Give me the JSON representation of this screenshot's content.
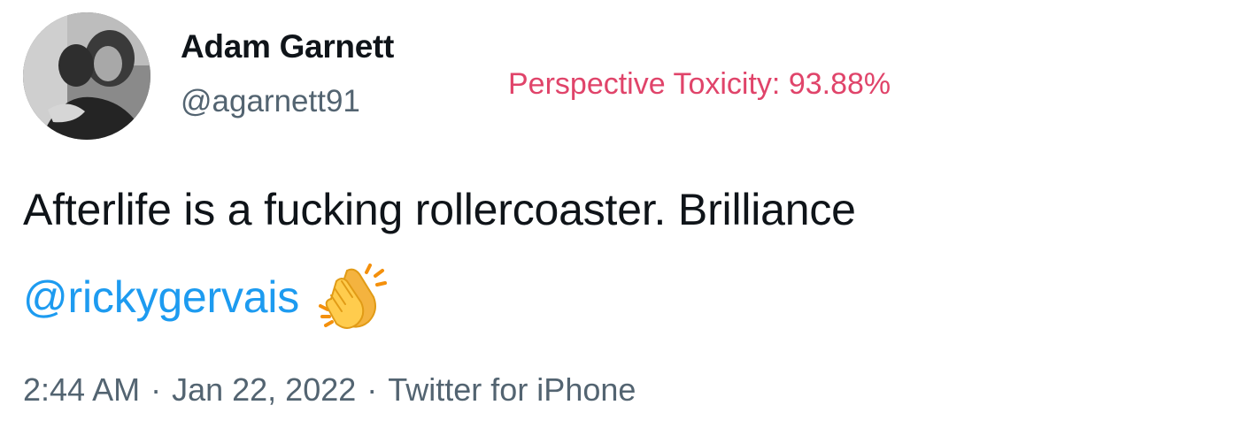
{
  "user": {
    "display_name": "Adam Garnett",
    "handle": "@agarnett91"
  },
  "annotation": {
    "toxicity_label": "Perspective Toxicity: 93.88%",
    "color": "#e0446a"
  },
  "tweet": {
    "text_line1": "Afterlife is a fucking rollercoaster. Brilliance",
    "mention": "@rickygervais",
    "emoji_icon": "clapping-hands-icon"
  },
  "meta": {
    "time": "2:44 AM",
    "separator": "·",
    "date": "Jan 22, 2022",
    "source": "Twitter for iPhone"
  },
  "colors": {
    "text_primary": "#0f1419",
    "text_secondary": "#536471",
    "link": "#1d9bf0"
  }
}
